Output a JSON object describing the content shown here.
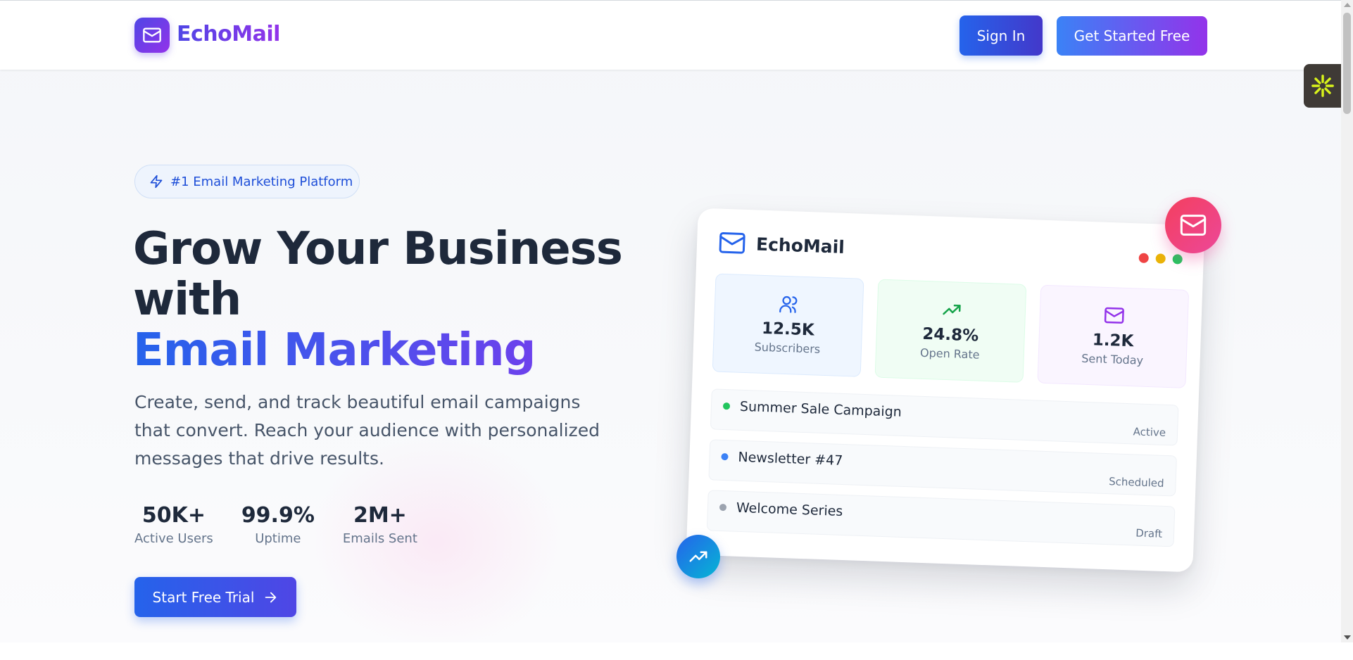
{
  "header": {
    "brand": "EchoMail",
    "sign_in_label": "Sign In",
    "get_started_label": "Get Started Free"
  },
  "hero": {
    "badge": "#1 Email Marketing Platform",
    "headline_line1": "Grow Your Business",
    "headline_line2": "with",
    "headline_accent": "Email Marketing",
    "description": "Create, send, and track beautiful email campaigns that convert. Reach your audience with personalized messages that drive results.",
    "stats": [
      {
        "value": "50K+",
        "label": "Active Users"
      },
      {
        "value": "99.9%",
        "label": "Uptime"
      },
      {
        "value": "2M+",
        "label": "Emails Sent"
      }
    ],
    "cta_label": "Start Free Trial"
  },
  "dashboard": {
    "title": "EchoMail",
    "window_dots": [
      "#ef4444",
      "#eab308",
      "#22c55e"
    ],
    "metrics": [
      {
        "value": "12.5K",
        "label": "Subscribers",
        "icon": "users-icon",
        "color": "#2563eb",
        "bg": "#eff6ff",
        "border": "#dbeafe"
      },
      {
        "value": "24.8%",
        "label": "Open Rate",
        "icon": "trending-up-icon",
        "color": "#16a34a",
        "bg": "#f0fdf4",
        "border": "#dcfce7"
      },
      {
        "value": "1.2K",
        "label": "Sent Today",
        "icon": "mail-icon",
        "color": "#9333ea",
        "bg": "#faf5ff",
        "border": "#f3e8ff"
      }
    ],
    "campaigns": [
      {
        "name": "Summer Sale Campaign",
        "status": "Active",
        "dot": "#22c55e"
      },
      {
        "name": "Newsletter #47",
        "status": "Scheduled",
        "dot": "#3b82f6"
      },
      {
        "name": "Welcome Series",
        "status": "Draft",
        "dot": "#9ca3af"
      }
    ]
  },
  "colors": {
    "brand_start": "#4f46e5",
    "brand_end": "#9333ea",
    "primary": "#2563eb",
    "text_dark": "#1e293b"
  }
}
